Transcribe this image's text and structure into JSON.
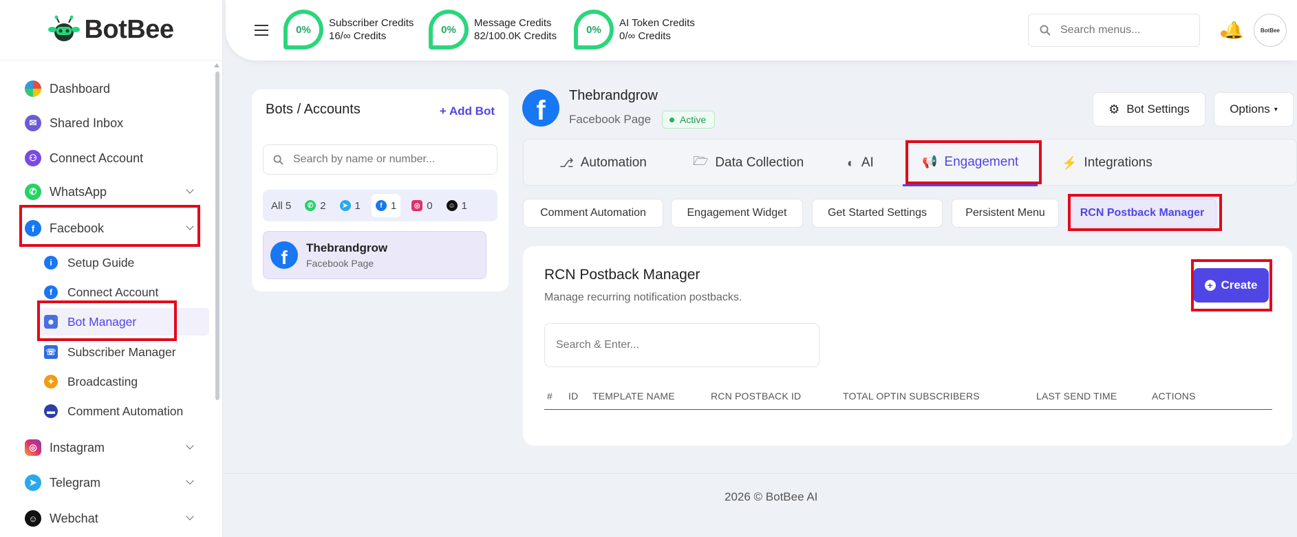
{
  "brand": {
    "name": "BotBee"
  },
  "sidebar": {
    "items": [
      {
        "label": "Dashboard",
        "icon": "dashboard-icon"
      },
      {
        "label": "Shared Inbox",
        "icon": "shared-inbox-icon"
      },
      {
        "label": "Connect Account",
        "icon": "connect-account-icon"
      },
      {
        "label": "WhatsApp",
        "icon": "whatsapp-icon"
      },
      {
        "label": "Facebook",
        "icon": "facebook-icon"
      },
      {
        "label": "Instagram",
        "icon": "instagram-icon"
      },
      {
        "label": "Telegram",
        "icon": "telegram-icon"
      },
      {
        "label": "Webchat",
        "icon": "webchat-icon"
      }
    ],
    "facebook_sub": [
      {
        "label": "Setup Guide",
        "icon": "info-icon"
      },
      {
        "label": "Connect Account",
        "icon": "facebook-icon"
      },
      {
        "label": "Bot Manager",
        "icon": "robot-icon"
      },
      {
        "label": "Subscriber Manager",
        "icon": "subscriber-icon"
      },
      {
        "label": "Broadcasting",
        "icon": "broadcast-icon"
      },
      {
        "label": "Comment Automation",
        "icon": "comment-icon"
      }
    ]
  },
  "topbar": {
    "credits": [
      {
        "percent": "0%",
        "title": "Subscriber Credits",
        "value": "16/∞ Credits"
      },
      {
        "percent": "0%",
        "title": "Message Credits",
        "value": "82/100.0K Credits"
      },
      {
        "percent": "0%",
        "title": "AI Token Credits",
        "value": "0/∞ Credits"
      }
    ],
    "search_placeholder": "Search menus...",
    "avatar_text": "BotBee"
  },
  "bots": {
    "title": "Bots / Accounts",
    "add_label": "Add Bot",
    "search_placeholder": "Search by name or number...",
    "filters": [
      {
        "label": "All",
        "count": "5"
      },
      {
        "icon": "whatsapp-icon",
        "count": "2"
      },
      {
        "icon": "telegram-icon",
        "count": "1"
      },
      {
        "icon": "facebook-icon",
        "count": "1"
      },
      {
        "icon": "instagram-icon",
        "count": "0"
      },
      {
        "icon": "webchat-icon",
        "count": "1"
      }
    ],
    "entry": {
      "name": "Thebrandgrow",
      "type": "Facebook Page"
    }
  },
  "page": {
    "name": "Thebrandgrow",
    "type": "Facebook Page",
    "status": "Active",
    "bot_settings_label": "Bot Settings",
    "options_label": "Options"
  },
  "tabs": [
    {
      "label": "Automation",
      "icon": "automation-icon"
    },
    {
      "label": "Data Collection",
      "icon": "folder-icon"
    },
    {
      "label": "AI",
      "icon": "brain-icon"
    },
    {
      "label": "Engagement",
      "icon": "megaphone-icon"
    },
    {
      "label": "Integrations",
      "icon": "plug-icon"
    }
  ],
  "subtabs": [
    "Comment Automation",
    "Engagement Widget",
    "Get Started Settings",
    "Persistent Menu",
    "RCN Postback Manager"
  ],
  "main": {
    "title": "RCN Postback Manager",
    "subtitle": "Manage recurring notification postbacks.",
    "create_label": "Create",
    "search_placeholder": "Search & Enter...",
    "columns": [
      "#",
      "ID",
      "TEMPLATE NAME",
      "RCN POSTBACK ID",
      "TOTAL OPTIN SUBSCRIBERS",
      "LAST SEND TIME",
      "ACTIONS"
    ]
  },
  "footer": {
    "text": "2026 © BotBee AI"
  },
  "colors": {
    "accent": "#4f46e5",
    "credit_ring": "#2bd67b",
    "facebook": "#1877f2",
    "highlight": "#e3061a"
  }
}
